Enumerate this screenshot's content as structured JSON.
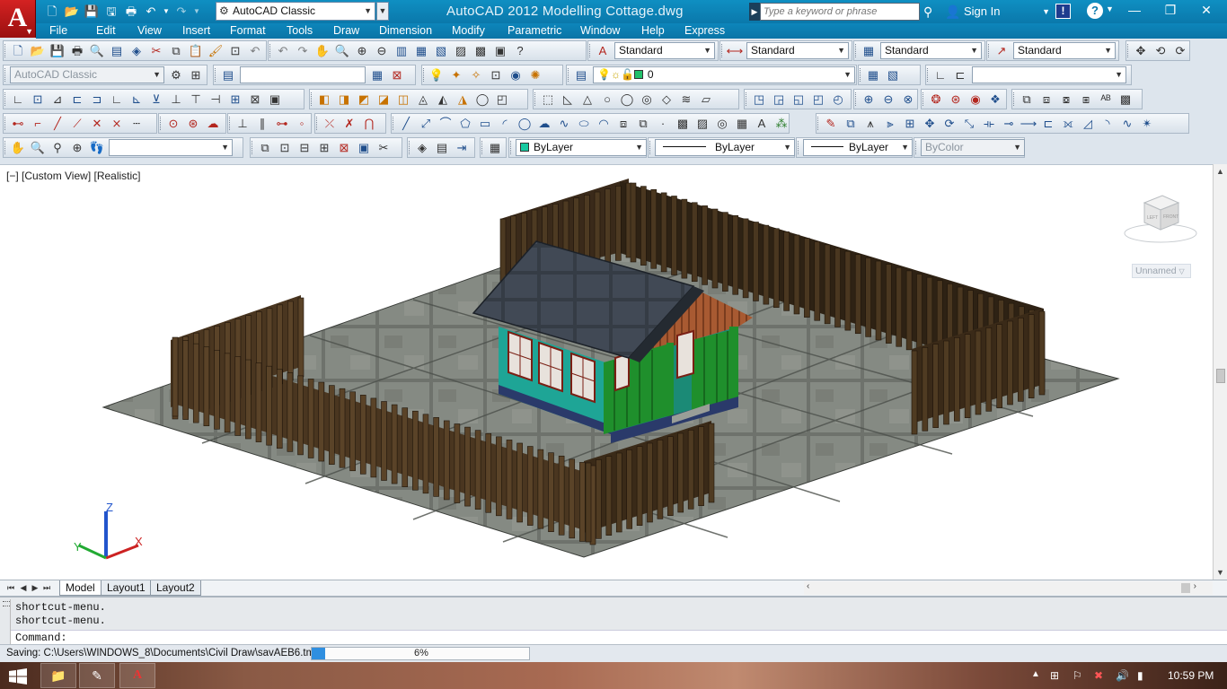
{
  "title_bar": {
    "logo_letter": "A",
    "workspace": "AutoCAD Classic",
    "window_title": "AutoCAD 2012    Modelling Cottage.dwg",
    "search_placeholder": "Type a keyword or phrase",
    "sign_in": "Sign In",
    "exchange_label": "!",
    "help_label": "?"
  },
  "menu": [
    "File",
    "Edit",
    "View",
    "Insert",
    "Format",
    "Tools",
    "Draw",
    "Dimension",
    "Modify",
    "Parametric",
    "Window",
    "Help",
    "Express"
  ],
  "toolbars": {
    "text_style": "Standard",
    "dim_style": "Standard",
    "table_style": "Standard",
    "multileader_style": "Standard",
    "workspace": "AutoCAD Classic",
    "layer": "0",
    "color": "ByLayer",
    "linetype": "ByLayer",
    "lineweight": "ByLayer",
    "plotstyle": "ByColor",
    "color_swatch": "#18c9a0",
    "layer_swatch": "#22c06a"
  },
  "viewport": {
    "label": "[−] [Custom View] [Realistic]",
    "viewcube_top": "LEFT",
    "viewcube_front": "FRONT",
    "named_view": "Unnamed",
    "axes": {
      "x": "X",
      "y": "Y",
      "z": "Z"
    }
  },
  "layout_tabs": [
    "Model",
    "Layout1",
    "Layout2"
  ],
  "command": {
    "history": [
      "shortcut-menu.",
      "shortcut-menu."
    ],
    "prompt": "Command:"
  },
  "status": {
    "saving_text": "Saving: C:\\Users\\WINDOWS_8\\Documents\\Civil Draw\\savAEB6.tmp",
    "progress_percent": 6,
    "progress_label": "6%"
  },
  "taskbar": {
    "clock": "10:59 PM"
  },
  "colors": {
    "titlebar": "#0a78ab",
    "accent_red": "#c41c1c",
    "progress": "#2f8fe0"
  }
}
